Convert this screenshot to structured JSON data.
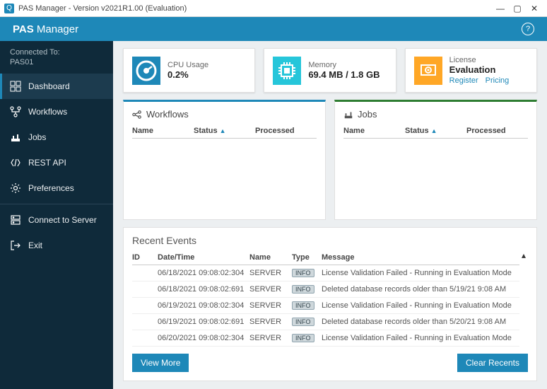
{
  "window": {
    "title": "PAS Manager - Version v2021R1.00 (Evaluation)",
    "icon": "Q"
  },
  "brand": {
    "bold": "PAS",
    "light": " Manager"
  },
  "connection": {
    "label": "Connected To:",
    "value": "PAS01"
  },
  "nav": {
    "dashboard": "Dashboard",
    "workflows": "Workflows",
    "jobs": "Jobs",
    "restapi": "REST API",
    "preferences": "Preferences",
    "connect": "Connect to Server",
    "exit": "Exit"
  },
  "cards": {
    "cpu": {
      "label": "CPU Usage",
      "value": "0.2%"
    },
    "mem": {
      "label": "Memory",
      "value": "69.4 MB / 1.8 GB"
    },
    "lic": {
      "label": "License",
      "value": "Evaluation",
      "register": "Register",
      "pricing": "Pricing"
    }
  },
  "wf": {
    "title": "Workflows",
    "cols": {
      "name": "Name",
      "status": "Status",
      "processed": "Processed"
    }
  },
  "jb": {
    "title": "Jobs",
    "cols": {
      "name": "Name",
      "status": "Status",
      "processed": "Processed"
    }
  },
  "events": {
    "title": "Recent Events",
    "cols": {
      "id": "ID",
      "dt": "Date/Time",
      "name": "Name",
      "type": "Type",
      "msg": "Message"
    },
    "btn_more": "View More",
    "btn_clear": "Clear Recents",
    "rows": [
      {
        "dt": "06/18/2021 09:08:02:304",
        "name": "SERVER",
        "type": "INFO",
        "msg": "License Validation Failed - Running in Evaluation Mode"
      },
      {
        "dt": "06/18/2021 09:08:02:691",
        "name": "SERVER",
        "type": "INFO",
        "msg": "Deleted database records older than 5/19/21 9:08 AM"
      },
      {
        "dt": "06/19/2021 09:08:02:304",
        "name": "SERVER",
        "type": "INFO",
        "msg": "License Validation Failed - Running in Evaluation Mode"
      },
      {
        "dt": "06/19/2021 09:08:02:691",
        "name": "SERVER",
        "type": "INFO",
        "msg": "Deleted database records older than 5/20/21 9:08 AM"
      },
      {
        "dt": "06/20/2021 09:08:02:304",
        "name": "SERVER",
        "type": "INFO",
        "msg": "License Validation Failed - Running in Evaluation Mode"
      }
    ]
  }
}
